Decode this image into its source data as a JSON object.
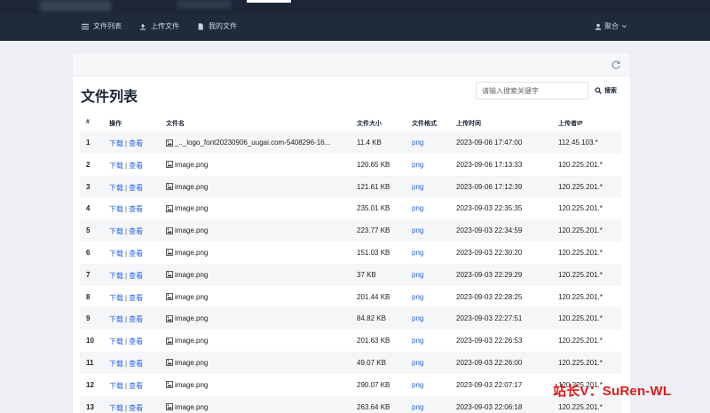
{
  "nav": {
    "items": [
      {
        "label": "文件列表",
        "icon": "list-icon"
      },
      {
        "label": "上传文件",
        "icon": "upload-icon"
      },
      {
        "label": "我的文件",
        "icon": "file-icon"
      }
    ],
    "user": {
      "label": "聚合",
      "icon": "user-icon"
    }
  },
  "page": {
    "title": "文件列表",
    "search_placeholder": "请输入搜索关键字",
    "search_label": "搜索"
  },
  "table": {
    "headers": [
      "#",
      "操作",
      "文件名",
      "文件大小",
      "文件格式",
      "上传时间",
      "上传者IP"
    ],
    "download_label": "下载",
    "separator": "|",
    "view_label": "查看",
    "rows": [
      {
        "num": "1",
        "name": "_.._logo_font20230906_uugai.com-5408296-16...",
        "size": "11.4 KB",
        "format": "png",
        "time": "2023-09-06 17:47:00",
        "ip": "112.45.103.*"
      },
      {
        "num": "2",
        "name": "image.png",
        "size": "120.65 KB",
        "format": "png",
        "time": "2023-09-06 17:13:33",
        "ip": "120.225.201.*"
      },
      {
        "num": "3",
        "name": "image.png",
        "size": "121.61 KB",
        "format": "png",
        "time": "2023-09-06 17:12:39",
        "ip": "120.225.201.*"
      },
      {
        "num": "4",
        "name": "image.png",
        "size": "235.01 KB",
        "format": "png",
        "time": "2023-09-03 22:35:35",
        "ip": "120.225.201.*"
      },
      {
        "num": "5",
        "name": "image.png",
        "size": "223.77 KB",
        "format": "png",
        "time": "2023-09-03 22:34:59",
        "ip": "120.225.201.*"
      },
      {
        "num": "6",
        "name": "image.png",
        "size": "151.03 KB",
        "format": "png",
        "time": "2023-09-03 22:30:20",
        "ip": "120.225.201.*"
      },
      {
        "num": "7",
        "name": "image.png",
        "size": "37 KB",
        "format": "png",
        "time": "2023-09-03 22:29:29",
        "ip": "120.225.201.*"
      },
      {
        "num": "8",
        "name": "image.png",
        "size": "201.44 KB",
        "format": "png",
        "time": "2023-09-03 22:28:25",
        "ip": "120.225.201.*"
      },
      {
        "num": "9",
        "name": "image.png",
        "size": "84.82 KB",
        "format": "png",
        "time": "2023-09-03 22:27:51",
        "ip": "120.225.201.*"
      },
      {
        "num": "10",
        "name": "image.png",
        "size": "201.63 KB",
        "format": "png",
        "time": "2023-09-03 22:26:53",
        "ip": "120.225.201.*"
      },
      {
        "num": "11",
        "name": "image.png",
        "size": "49.07 KB",
        "format": "png",
        "time": "2023-09-03 22:26:00",
        "ip": "120.225.201.*"
      },
      {
        "num": "12",
        "name": "image.png",
        "size": "290.07 KB",
        "format": "png",
        "time": "2023-09-03 22:07:17",
        "ip": "120.225.201.*"
      },
      {
        "num": "13",
        "name": "image.png",
        "size": "263.64 KB",
        "format": "png",
        "time": "2023-09-03 22:06:18",
        "ip": "120.225.201.*"
      }
    ]
  },
  "watermark": "站长V：SuRen-WL",
  "colors": {
    "header_bg": "#1f2a3b",
    "link": "#2563eb",
    "watermark": "#e11919"
  }
}
